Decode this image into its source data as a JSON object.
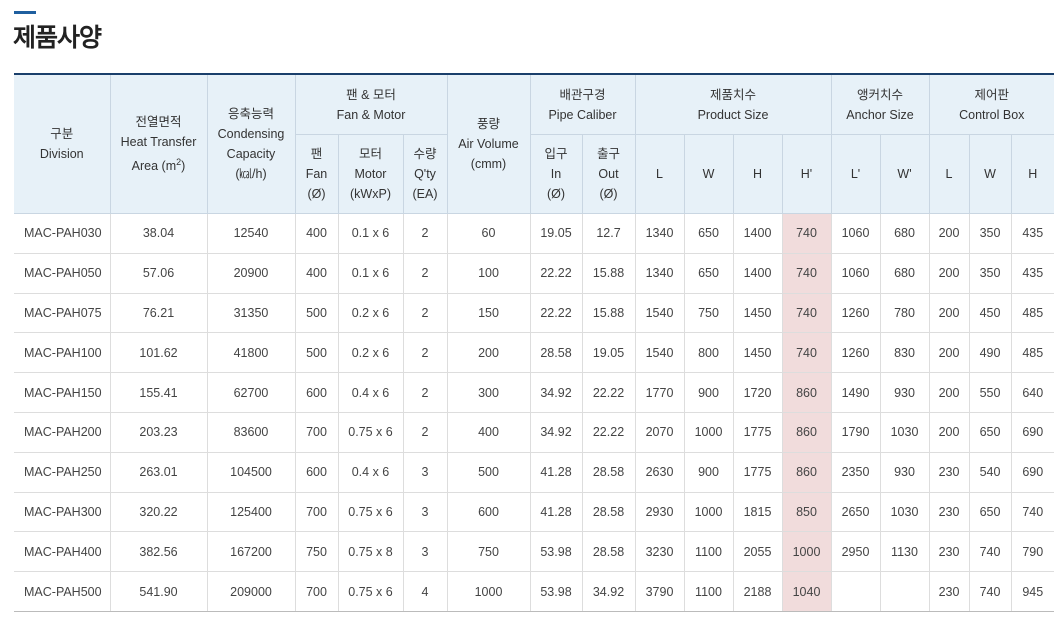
{
  "page_title": "제품사양",
  "headers": {
    "division": [
      "구분",
      "Division"
    ],
    "area": [
      "전열면적",
      "Heat Transfer",
      "Area (m",
      "2",
      ")"
    ],
    "capacity": [
      "응축능력",
      "Condensing",
      "Capacity",
      "(㎉/h)"
    ],
    "fan_motor": [
      "팬 & 모터",
      "Fan & Motor"
    ],
    "fan": [
      "팬",
      "Fan",
      "(Ø)"
    ],
    "motor": [
      "모터",
      "Motor",
      "(kWxP)"
    ],
    "qty": [
      "수량",
      "Q'ty",
      "(EA)"
    ],
    "air": [
      "풍량",
      "Air Volume",
      "(cmm)"
    ],
    "pipe": [
      "배관구경",
      "Pipe Caliber"
    ],
    "pipe_in": [
      "입구",
      "In",
      "(Ø)"
    ],
    "pipe_out": [
      "출구",
      "Out",
      "(Ø)"
    ],
    "size": [
      "제품치수",
      "Product Size"
    ],
    "size_cols": [
      "L",
      "W",
      "H",
      "H'"
    ],
    "anchor": [
      "앵커치수",
      "Anchor Size"
    ],
    "anchor_cols": [
      "L'",
      "W'"
    ],
    "control": [
      "제어판",
      "Control Box"
    ],
    "control_cols": [
      "L",
      "W",
      "H"
    ]
  },
  "rows": [
    [
      "MAC-PAH030",
      "38.04",
      "12540",
      "400",
      "0.1 x 6",
      "2",
      "60",
      "19.05",
      "12.7",
      "1340",
      "650",
      "1400",
      "740",
      "1060",
      "680",
      "200",
      "350",
      "435"
    ],
    [
      "MAC-PAH050",
      "57.06",
      "20900",
      "400",
      "0.1 x 6",
      "2",
      "100",
      "22.22",
      "15.88",
      "1340",
      "650",
      "1400",
      "740",
      "1060",
      "680",
      "200",
      "350",
      "435"
    ],
    [
      "MAC-PAH075",
      "76.21",
      "31350",
      "500",
      "0.2 x 6",
      "2",
      "150",
      "22.22",
      "15.88",
      "1540",
      "750",
      "1450",
      "740",
      "1260",
      "780",
      "200",
      "450",
      "485"
    ],
    [
      "MAC-PAH100",
      "101.62",
      "41800",
      "500",
      "0.2 x 6",
      "2",
      "200",
      "28.58",
      "19.05",
      "1540",
      "800",
      "1450",
      "740",
      "1260",
      "830",
      "200",
      "490",
      "485"
    ],
    [
      "MAC-PAH150",
      "155.41",
      "62700",
      "600",
      "0.4 x 6",
      "2",
      "300",
      "34.92",
      "22.22",
      "1770",
      "900",
      "1720",
      "860",
      "1490",
      "930",
      "200",
      "550",
      "640"
    ],
    [
      "MAC-PAH200",
      "203.23",
      "83600",
      "700",
      "0.75 x 6",
      "2",
      "400",
      "34.92",
      "22.22",
      "2070",
      "1000",
      "1775",
      "860",
      "1790",
      "1030",
      "200",
      "650",
      "690"
    ],
    [
      "MAC-PAH250",
      "263.01",
      "104500",
      "600",
      "0.4 x 6",
      "3",
      "500",
      "41.28",
      "28.58",
      "2630",
      "900",
      "1775",
      "860",
      "2350",
      "930",
      "230",
      "540",
      "690"
    ],
    [
      "MAC-PAH300",
      "320.22",
      "125400",
      "700",
      "0.75 x 6",
      "3",
      "600",
      "41.28",
      "28.58",
      "2930",
      "1000",
      "1815",
      "850",
      "2650",
      "1030",
      "230",
      "650",
      "740"
    ],
    [
      "MAC-PAH400",
      "382.56",
      "167200",
      "750",
      "0.75 x 8",
      "3",
      "750",
      "53.98",
      "28.58",
      "3230",
      "1100",
      "2055",
      "1000",
      "2950",
      "1130",
      "230",
      "740",
      "790"
    ],
    [
      "MAC-PAH500",
      "541.90",
      "209000",
      "700",
      "0.75 x 6",
      "4",
      "1000",
      "53.98",
      "34.92",
      "3790",
      "1100",
      "2188",
      "1040",
      "",
      "",
      "230",
      "740",
      "945"
    ]
  ],
  "colors": {
    "header_bg": "#e7f1f8",
    "highlight_bg": "#f1dcdc",
    "accent": "#1f5f9f"
  }
}
